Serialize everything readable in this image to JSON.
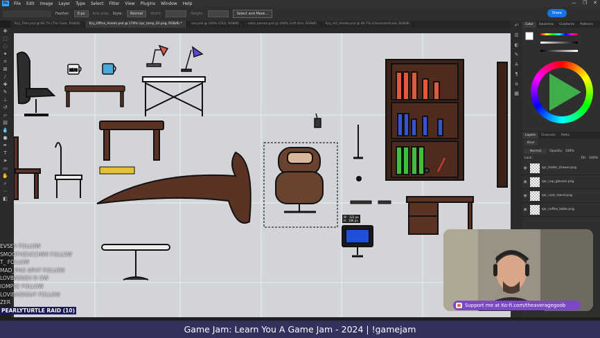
{
  "menu": {
    "app_icon": "Ps",
    "items": [
      "File",
      "Edit",
      "Image",
      "Layer",
      "Type",
      "Select",
      "Filter",
      "View",
      "Plugins",
      "Window",
      "Help"
    ],
    "window_controls": [
      "—",
      "❐",
      "✕"
    ]
  },
  "options_bar": {
    "feather_label": "Feather:",
    "feather_value": "0 px",
    "antialias_label": "Anti-alias",
    "style_label": "Style:",
    "style_value": "Normal",
    "width_label": "Width:",
    "height_label": "Height:",
    "select_mask_label": "Select and Mask...",
    "share_label": "Share"
  },
  "doc_tabs": [
    {
      "label": "Kcy_Tiles.psd @ 66.7% (Tile Color, RGB/8)",
      "active": false
    },
    {
      "label": "Kcy_Office_Assets.psd @ 179% (spr_lamp_02.png, RGB/8) *",
      "active": true
    },
    {
      "label": "ceo.psd @ 100% (CEO, RGB/8)",
      "active": false
    },
    {
      "label": "sales person.psd @ 100% (Left Arm, RGB/8)",
      "active": false
    },
    {
      "label": "Kcy_Art_Assets.psd @ 66.7% (CharacterScale, RGB/8)",
      "active": false
    }
  ],
  "canvas": {
    "selection_readout": "W : 123 px\nH : 166 px",
    "background_color": "#d2d4d7"
  },
  "panels": {
    "color_tabs": [
      "Color",
      "Swatches",
      "Gradients",
      "Patterns"
    ],
    "layers_tabs": [
      "Layers",
      "Channels",
      "Paths"
    ],
    "kind_label": "Kind",
    "blend_mode": "Normal",
    "opacity_label": "Opacity:",
    "opacity_value": "100%",
    "fill_label": "Fill:",
    "fill_value": "100%",
    "lock_label": "Lock:",
    "layers": [
      "spr_folder_drawer.png",
      "spr_cup_glasses.png",
      "spr_coat_stand.png",
      "spr_coffee_table.png"
    ]
  },
  "chat": {
    "lines": [
      "EVSEV  FOLLOW",
      "SMOOTHZUCCHINI  FOLLOW",
      "T_ FOLLOW",
      "MAD_PHO  APHY  FOLLOW",
      "LOVBASSGU  D  OW",
      "IOMP02  FOLLOW",
      "LOVIBASSGUY  FOLLOW",
      "ZER"
    ],
    "raid": "PEARLYTURTLE RAID (10)"
  },
  "kofi": {
    "text": "Support me at Ko-fi.com/theaveragegoob"
  },
  "stream_title": "Game Jam: Learn You A Game Jam - 2024 | !gamejam",
  "colors": {
    "accent": "#1473e6",
    "kofi": "#7b49c7",
    "title_bar": "#33315e"
  }
}
